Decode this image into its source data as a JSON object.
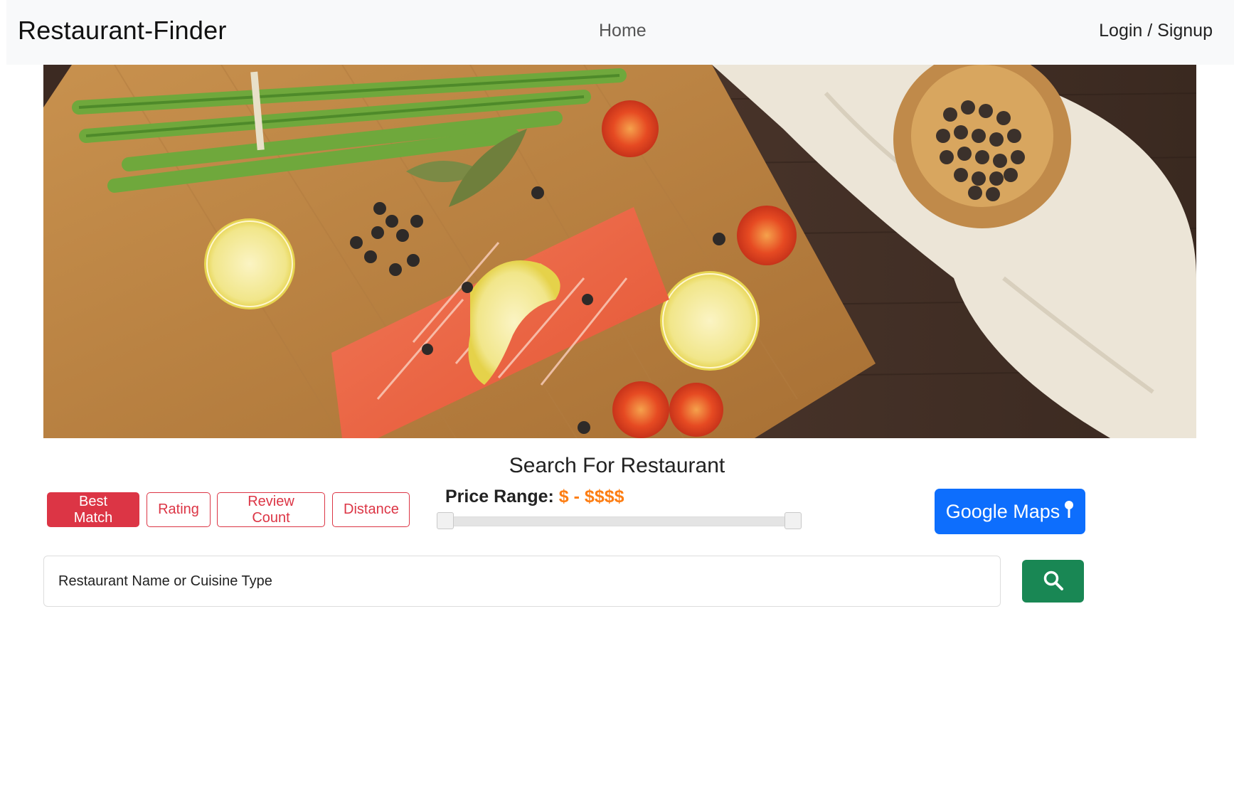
{
  "navbar": {
    "brand": "Restaurant-Finder",
    "home_label": "Home",
    "login_label": "Login / Signup"
  },
  "hero": {
    "image_description": "hero-food-image"
  },
  "search": {
    "title": "Search For Restaurant",
    "sort_buttons": [
      {
        "label": "Best Match",
        "active": true
      },
      {
        "label": "Rating",
        "active": false
      },
      {
        "label": "Review Count",
        "active": false
      },
      {
        "label": "Distance",
        "active": false
      }
    ],
    "price_range_label": "Price Range:",
    "price_range_value": "$ - $$$$",
    "maps_label": "Google Maps",
    "input_placeholder": "Restaurant Name or Cuisine Type"
  },
  "colors": {
    "danger": "#dc3545",
    "primary": "#0d6efd",
    "success": "#198754",
    "accent": "#fd7e14",
    "navbar_bg": "#f8f9fa"
  }
}
